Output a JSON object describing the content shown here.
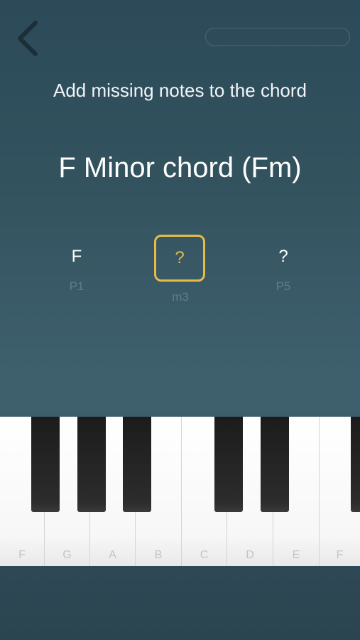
{
  "header": {
    "back_icon": "chevron-left-icon",
    "progress_fraction": 0
  },
  "instruction": "Add missing notes to the chord",
  "chord_title": "F Minor chord (Fm)",
  "notes": [
    {
      "note": "F",
      "interval": "P1",
      "selected": false
    },
    {
      "note": "?",
      "interval": "m3",
      "selected": true
    },
    {
      "note": "?",
      "interval": "P5",
      "selected": false
    }
  ],
  "colors": {
    "accent": "#e7bc45",
    "background": "#3e5f6c",
    "interval_label": "#5f7e8a"
  },
  "keyboard": {
    "white_keys": [
      "F",
      "G",
      "A",
      "B",
      "C",
      "D",
      "E",
      "F"
    ],
    "black_keys_count": 6
  }
}
